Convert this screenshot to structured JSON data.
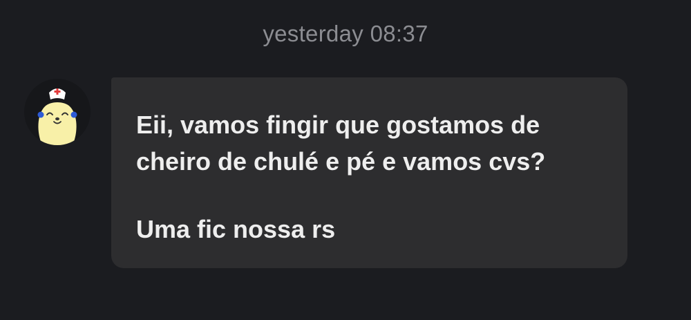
{
  "chat": {
    "timestamp": "yesterday 08:37",
    "message": {
      "lines": [
        "Eii, vamos fingir que gostamos de",
        "cheiro de chulé e pé e vamos cvs?"
      ],
      "second_paragraph": "Uma fic nossa rs"
    },
    "sender_avatar_icon": "nurse-mascot-avatar"
  },
  "colors": {
    "background": "#1b1c20",
    "bubble": "#2d2d2f",
    "text": "#eeeeee",
    "timestamp": "#8c8d92",
    "avatar_face": "#f8f0a8",
    "avatar_accent": "#2d5bd6"
  }
}
